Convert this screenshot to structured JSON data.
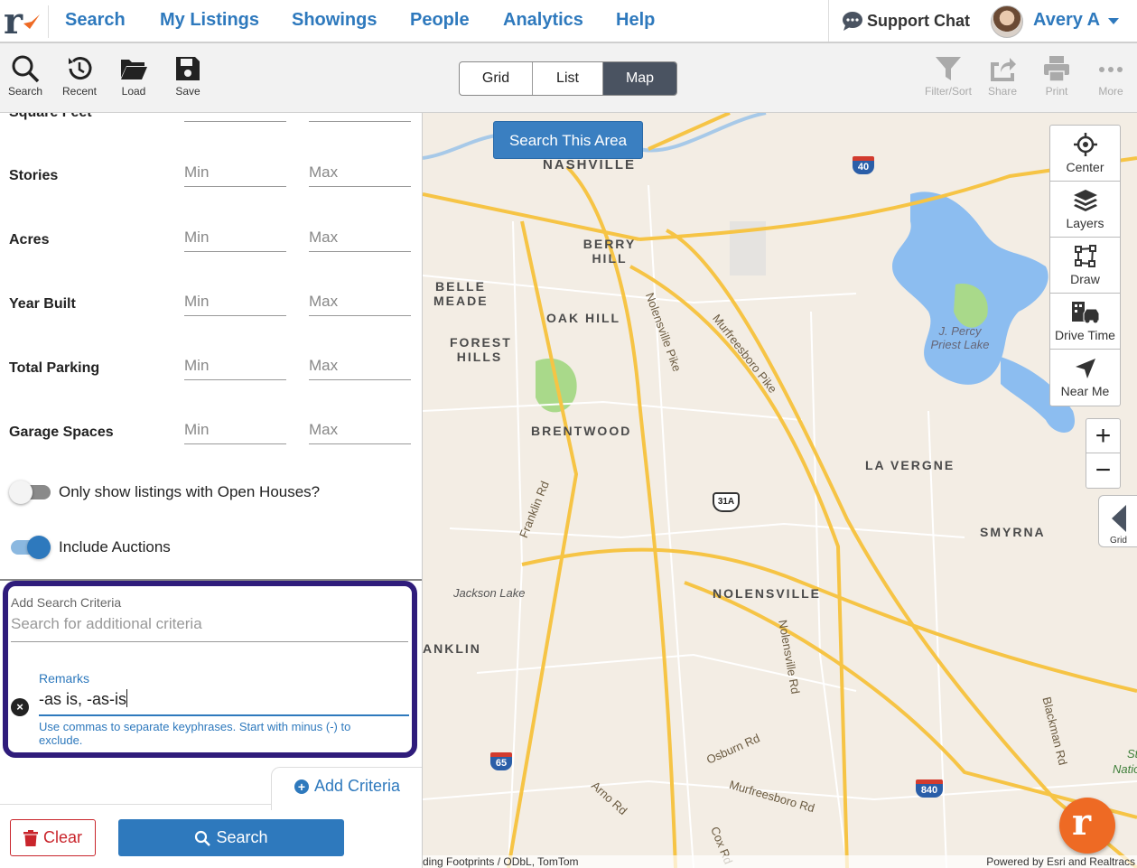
{
  "nav": {
    "links": [
      "Search",
      "My Listings",
      "Showings",
      "People",
      "Analytics",
      "Help"
    ],
    "support": "Support Chat",
    "user": "Avery A"
  },
  "toolbar": {
    "left": [
      "Search",
      "Recent",
      "Load",
      "Save"
    ],
    "right": [
      "Filter/Sort",
      "Share",
      "Print",
      "More"
    ],
    "views": [
      "Grid",
      "List",
      "Map"
    ],
    "active_view": "Map"
  },
  "filters": {
    "partial_label": "Square Feet",
    "rows": [
      {
        "label": "Stories",
        "min": "Min",
        "max": "Max"
      },
      {
        "label": "Acres",
        "min": "Min",
        "max": "Max"
      },
      {
        "label": "Year Built",
        "min": "Min",
        "max": "Max"
      },
      {
        "label": "Total Parking",
        "min": "Min",
        "max": "Max"
      },
      {
        "label": "Garage Spaces",
        "min": "Min",
        "max": "Max"
      }
    ],
    "open_houses": {
      "label": "Only show listings with Open Houses?",
      "on": false
    },
    "auctions": {
      "label": "Include Auctions",
      "on": true
    }
  },
  "criteria": {
    "label": "Add Search Criteria",
    "placeholder": "Search for additional criteria",
    "remarks_label": "Remarks",
    "remarks_value": "-as is, -as-is",
    "remarks_help": "Use commas to separate keyphrases. Start with minus (-) to exclude.",
    "remove_icon": "×",
    "add_label": "Add Criteria"
  },
  "actions": {
    "clear": "Clear",
    "search": "Search"
  },
  "map": {
    "search_area": "Search This Area",
    "tools": [
      "Center",
      "Layers",
      "Draw",
      "Drive Time",
      "Near Me"
    ],
    "zoom_in": "+",
    "zoom_out": "−",
    "grid_tab": "Grid",
    "places": {
      "nashville": "NASHVILLE",
      "berry_hill": "BERRY HILL",
      "belle_meade": "BELLE MEADE",
      "oak_hill": "OAK HILL",
      "forest_hills": "FOREST HILLS",
      "brentwood": "BRENTWOOD",
      "la_vergne": "LA VERGNE",
      "smyrna": "SMYRNA",
      "nolensville": "NOLENSVILLE",
      "anklin": "ANKLIN",
      "jackson_lake": "Jackson Lake",
      "percy_priest": "J. Percy Priest Lake",
      "sto": "Sto",
      "nation": "Nation"
    },
    "roads": {
      "murfreesboro_pike": "Murfreesboro Pike",
      "nolensville_pike": "Nolensville Pike",
      "franklin_rd": "Franklin Rd",
      "nolensville_rd": "Nolensville Rd",
      "osburn_rd": "Osburn Rd",
      "murfreesboro_rd": "Murfreesboro Rd",
      "arno_rd": "Arno Rd",
      "cox_rd": "Cox Rd",
      "blackman_rd": "Blackman Rd"
    },
    "shields": {
      "i40": "40",
      "i65": "65",
      "i840": "840",
      "us31a": "31A"
    },
    "attribution_left": "ding Footprints / ODbL, TomTom",
    "attribution_right": "Powered by Esri and Realtracs"
  },
  "colors": {
    "brand_blue": "#2e79bd",
    "dark": "#4a5361",
    "danger": "#c9252c",
    "highlight_border": "#2f1c7b",
    "fab": "#ee6a24"
  }
}
